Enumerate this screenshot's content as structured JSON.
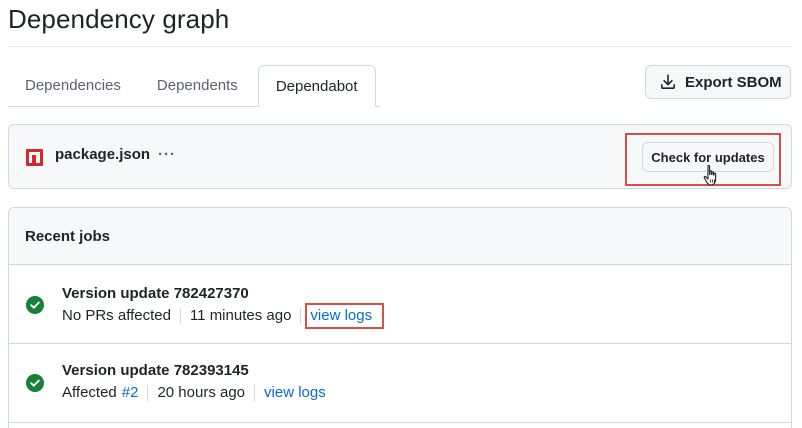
{
  "page": {
    "title": "Dependency graph"
  },
  "tabs": [
    {
      "label": "Dependencies",
      "active": false
    },
    {
      "label": "Dependents",
      "active": false
    },
    {
      "label": "Dependabot",
      "active": true
    }
  ],
  "export": {
    "label": "Export SBOM",
    "icon": "download-icon"
  },
  "manifest": {
    "icon": "npm-icon",
    "name": "package.json",
    "menu": "···",
    "check_label": "Check for updates"
  },
  "jobs": {
    "heading": "Recent jobs",
    "items": [
      {
        "title": "Version update 782427370",
        "status_icon": "check-circle-icon",
        "affected": "No PRs affected",
        "time": "11 minutes ago",
        "logs": "view logs"
      },
      {
        "title": "Version update 782393145",
        "status_icon": "check-circle-icon",
        "affected_prefix": "Affected",
        "pr": "#2",
        "time": "20 hours ago",
        "logs": "view logs"
      }
    ]
  },
  "colors": {
    "accent_link": "#0969da",
    "success": "#1a7f37",
    "highlight": "#d4504a",
    "npm_red": "#d8262b"
  }
}
